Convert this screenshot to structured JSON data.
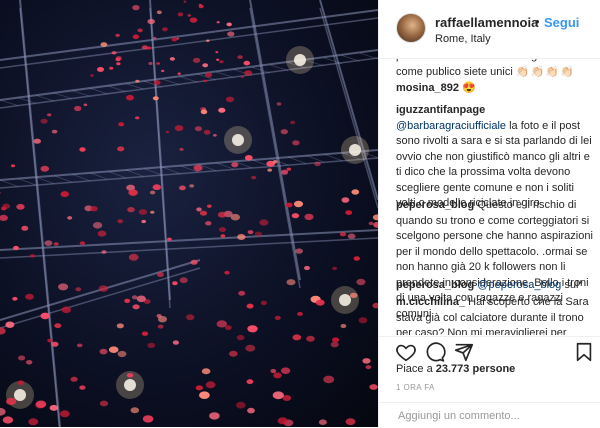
{
  "post": {
    "username": "raffaellamennoia",
    "separator": "•",
    "follow_label": "Segui",
    "location": "Rome, Italy"
  },
  "comments": [
    {
      "user": "",
      "text": "piacerebbe trascorrere una giornata come publico siete unici",
      "emoji": "👏🏻👏🏻👏🏻👏🏻",
      "mention": ""
    },
    {
      "user": "mosina_892",
      "text": "",
      "emoji": "😍",
      "mention": ""
    },
    {
      "user": "iguzzantifanpage",
      "mention": "@barbaragraciufficiale",
      "text": "la foto e il post sono rivolti a sara e si sta parlando di lei ovvio che non giustificò manco gli altri e ti dico che la prossima volta devono scegliere gente comune e non i soliti volti o modelle riciclate in giro",
      "emoji": ""
    },
    {
      "user": "peperosa_blog",
      "mention": "",
      "text": "Questo è il rischio di quando su trono e come corteggiatori si scelgono persone che hanno aspirazioni per il mondo dello spettacolo. .ormai se non hanno già 20 k followers non li prendete in considerazione. Bello i troni di una volta con ragazze e ragazzi comuni",
      "emoji": ""
    },
    {
      "user": "peperosa_blog",
      "mention": "@peperosa_blog",
      "text": "sul*",
      "emoji": ""
    },
    {
      "user": "m.cicchilina_",
      "mention": "",
      "text": "Hai scoperto che la Sara stava già col calciatore durante il trono per caso? Non mi meraviglierei per niente.",
      "emoji": ""
    }
  ],
  "actions": {
    "like_icon": "heart-icon",
    "comment_icon": "comment-icon",
    "share_icon": "share-icon",
    "save_icon": "bookmark-icon"
  },
  "likes": {
    "prefix": "Piace a",
    "count": "23.773",
    "suffix": "persone"
  },
  "time": "1 ORA FA",
  "add_comment": {
    "placeholder": "Aggiungi un commento..."
  },
  "colors": {
    "link": "#3897f0",
    "mention": "#003569",
    "confetti": "#e8334a",
    "stage": "#0b0f22"
  }
}
